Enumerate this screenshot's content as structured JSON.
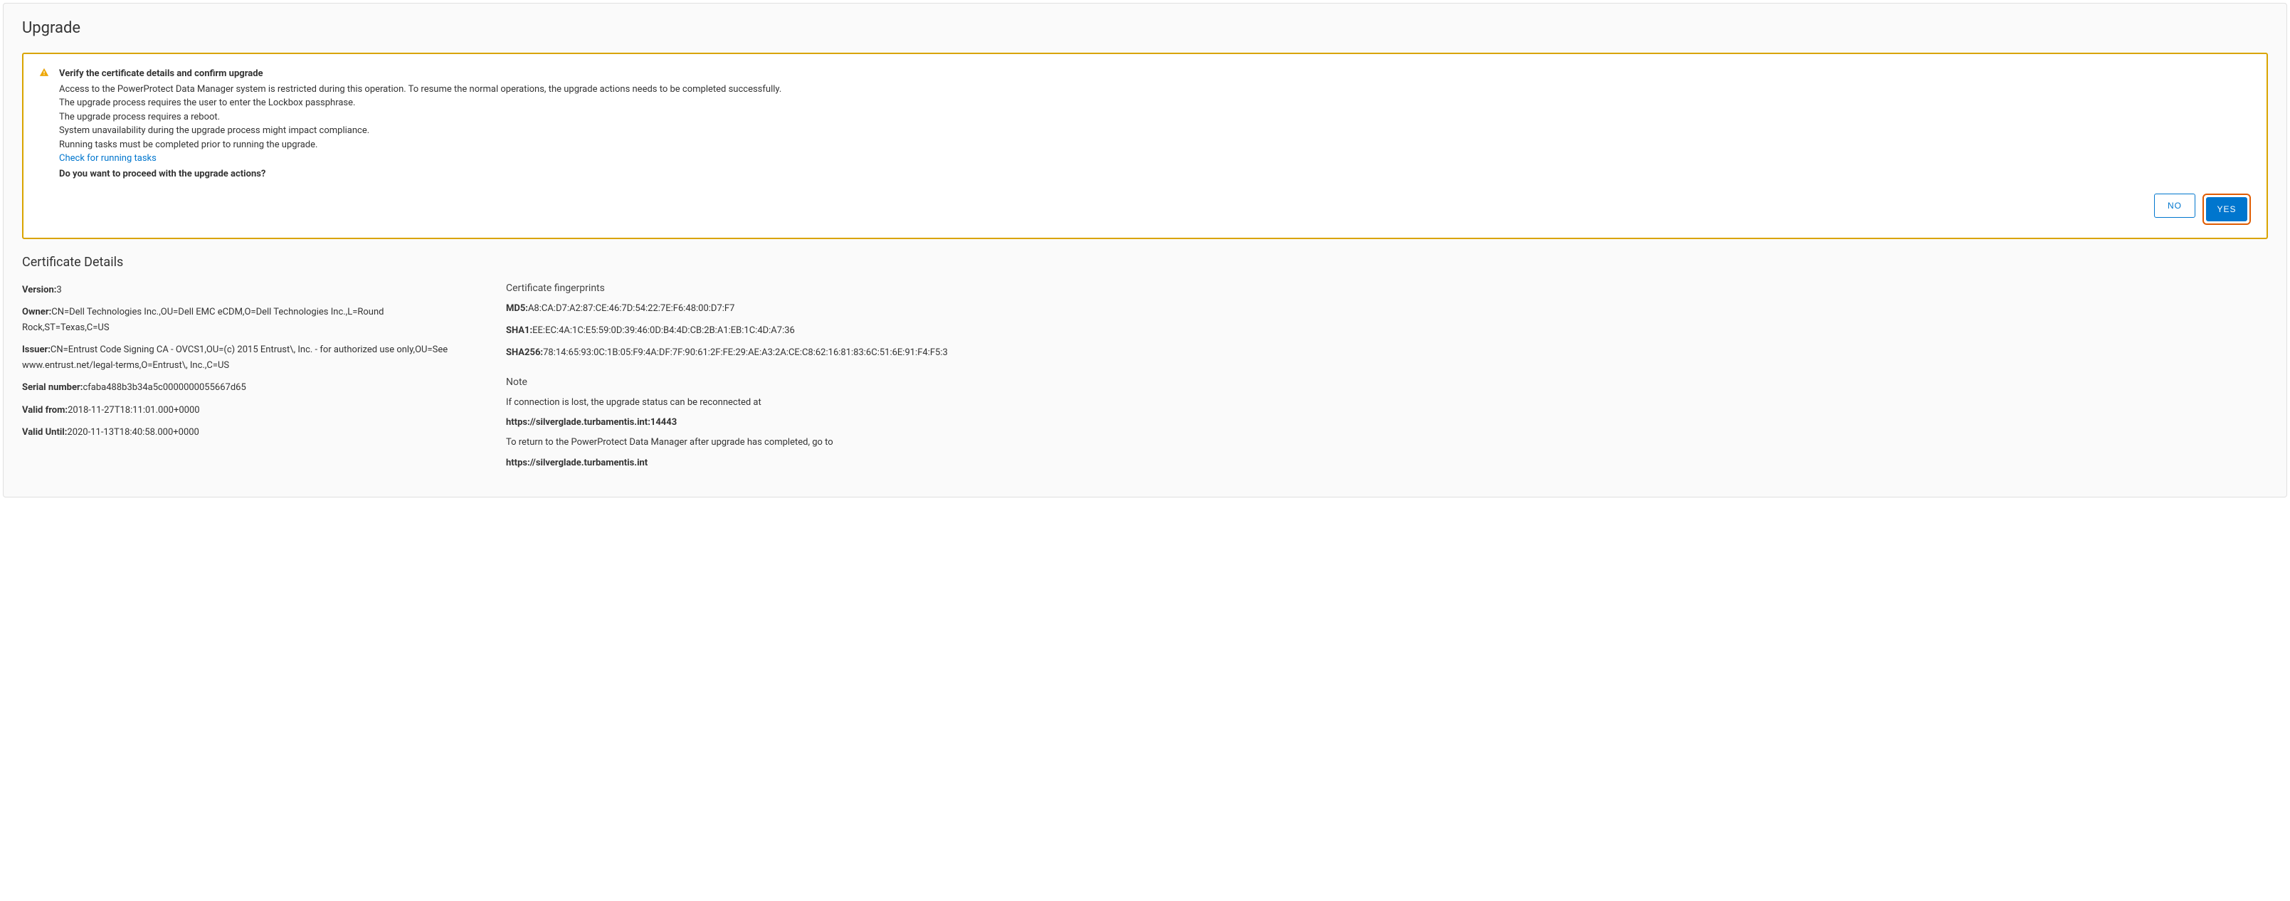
{
  "page": {
    "title": "Upgrade"
  },
  "alert": {
    "title": "Verify the certificate details and confirm upgrade",
    "lines": {
      "l1": "Access to the PowerProtect Data Manager system is restricted during this operation. To resume the normal operations, the upgrade actions needs to be completed successfully.",
      "l2": "The upgrade process requires the user to enter the Lockbox passphrase.",
      "l3": "The upgrade process requires a reboot.",
      "l4": "System unavailability during the upgrade process might impact compliance.",
      "l5": "Running tasks must be completed prior to running the upgrade."
    },
    "link": "Check for running tasks",
    "question": "Do you want to proceed with the upgrade actions?",
    "buttons": {
      "no": "NO",
      "yes": "YES"
    }
  },
  "cert": {
    "section_title": "Certificate Details",
    "version_label": "Version:",
    "version_value": "3",
    "owner_label": "Owner:",
    "owner_value": "CN=Dell Technologies Inc.,OU=Dell EMC eCDM,O=Dell Technologies Inc.,L=Round Rock,ST=Texas,C=US",
    "issuer_label": "Issuer:",
    "issuer_value": "CN=Entrust Code Signing CA - OVCS1,OU=(c) 2015 Entrust\\, Inc. - for authorized use only,OU=See www.entrust.net/legal-terms,O=Entrust\\, Inc.,C=US",
    "serial_label": "Serial number:",
    "serial_value": "cfaba488b3b34a5c0000000055667d65",
    "valid_from_label": "Valid from:",
    "valid_from_value": "2018-11-27T18:11:01.000+0000",
    "valid_until_label": "Valid Until:",
    "valid_until_value": "2020-11-13T18:40:58.000+0000"
  },
  "fingerprints": {
    "heading": "Certificate fingerprints",
    "md5_label": "MD5:",
    "md5_value": "A8:CA:D7:A2:87:CE:46:7D:54:22:7E:F6:48:00:D7:F7",
    "sha1_label": "SHA1:",
    "sha1_value": "EE:EC:4A:1C:E5:59:0D:39:46:0D:B4:4D:CB:2B:A1:EB:1C:4D:A7:36",
    "sha256_label": "SHA256:",
    "sha256_value": "78:14:65:93:0C:1B:05:F9:4A:DF:7F:90:61:2F:FE:29:AE:A3:2A:CE:C8:62:16:81:83:6C:51:6E:91:F4:F5:3"
  },
  "note": {
    "heading": "Note",
    "line1": "If connection is lost, the upgrade status can be reconnected at",
    "url1": "https://silverglade.turbamentis.int:14443",
    "line2": "To return to the PowerProtect Data Manager after upgrade has completed, go to",
    "url2": "https://silverglade.turbamentis.int"
  }
}
